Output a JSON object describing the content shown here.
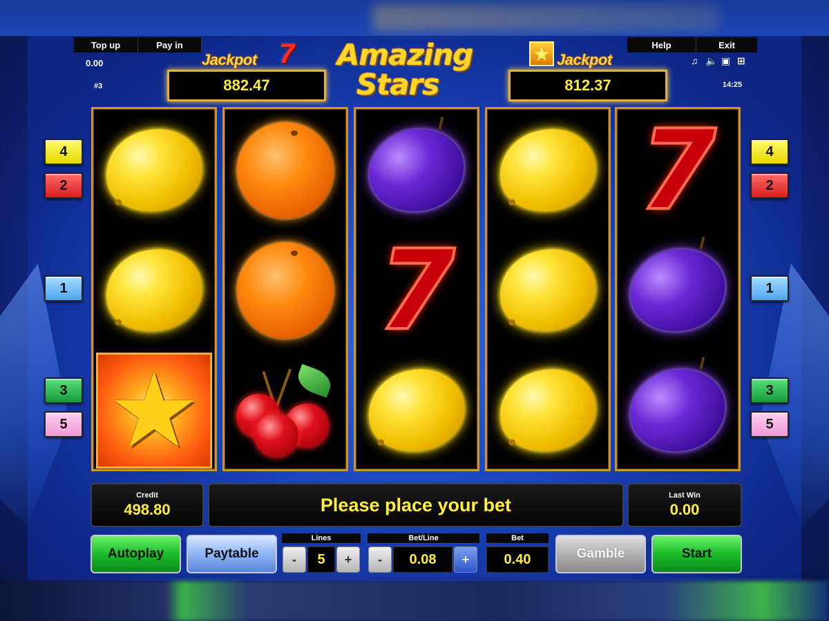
{
  "top_menu": {
    "top_up": "Top up",
    "pay_in": "Pay in",
    "help": "Help",
    "exit": "Exit"
  },
  "status": {
    "balance": "0.00",
    "game_number": "#3",
    "clock": "14:25"
  },
  "jackpots": {
    "left": {
      "label": "Jackpot",
      "symbol": "7",
      "value": "882.47"
    },
    "right": {
      "label": "Jackpot",
      "symbol": "star",
      "value": "812.37"
    }
  },
  "logo": {
    "line1": "Amazing",
    "line2": "Stars"
  },
  "system_icons": [
    "music-note-icon",
    "speaker-icon",
    "window-icon",
    "fullscreen-icon"
  ],
  "reels": [
    [
      "lemon",
      "lemon",
      "star"
    ],
    [
      "orange",
      "orange",
      "cherries"
    ],
    [
      "plum",
      "seven",
      "lemon"
    ],
    [
      "lemon",
      "lemon",
      "lemon"
    ],
    [
      "seven",
      "plum",
      "plum"
    ]
  ],
  "payline_markers": {
    "left": [
      "4",
      "2",
      "1",
      "3",
      "5"
    ],
    "right": [
      "4",
      "2",
      "1",
      "3",
      "5"
    ]
  },
  "bottom": {
    "credit_label": "Credit",
    "credit_value": "498.80",
    "message": "Please place your bet",
    "last_win_label": "Last Win",
    "last_win_value": "0.00"
  },
  "controls": {
    "autoplay": "Autoplay",
    "paytable": "Paytable",
    "lines_label": "Lines",
    "lines_value": "5",
    "bet_line_label": "Bet/Line",
    "bet_line_value": "0.08",
    "bet_label": "Bet",
    "bet_value": "0.40",
    "gamble": "Gamble",
    "start": "Start",
    "minus": "-",
    "plus": "+"
  },
  "colors": {
    "accent_yellow": "#ffef3a",
    "frame_gold": "#c9933a",
    "background_blue": "#1d3fb0"
  }
}
